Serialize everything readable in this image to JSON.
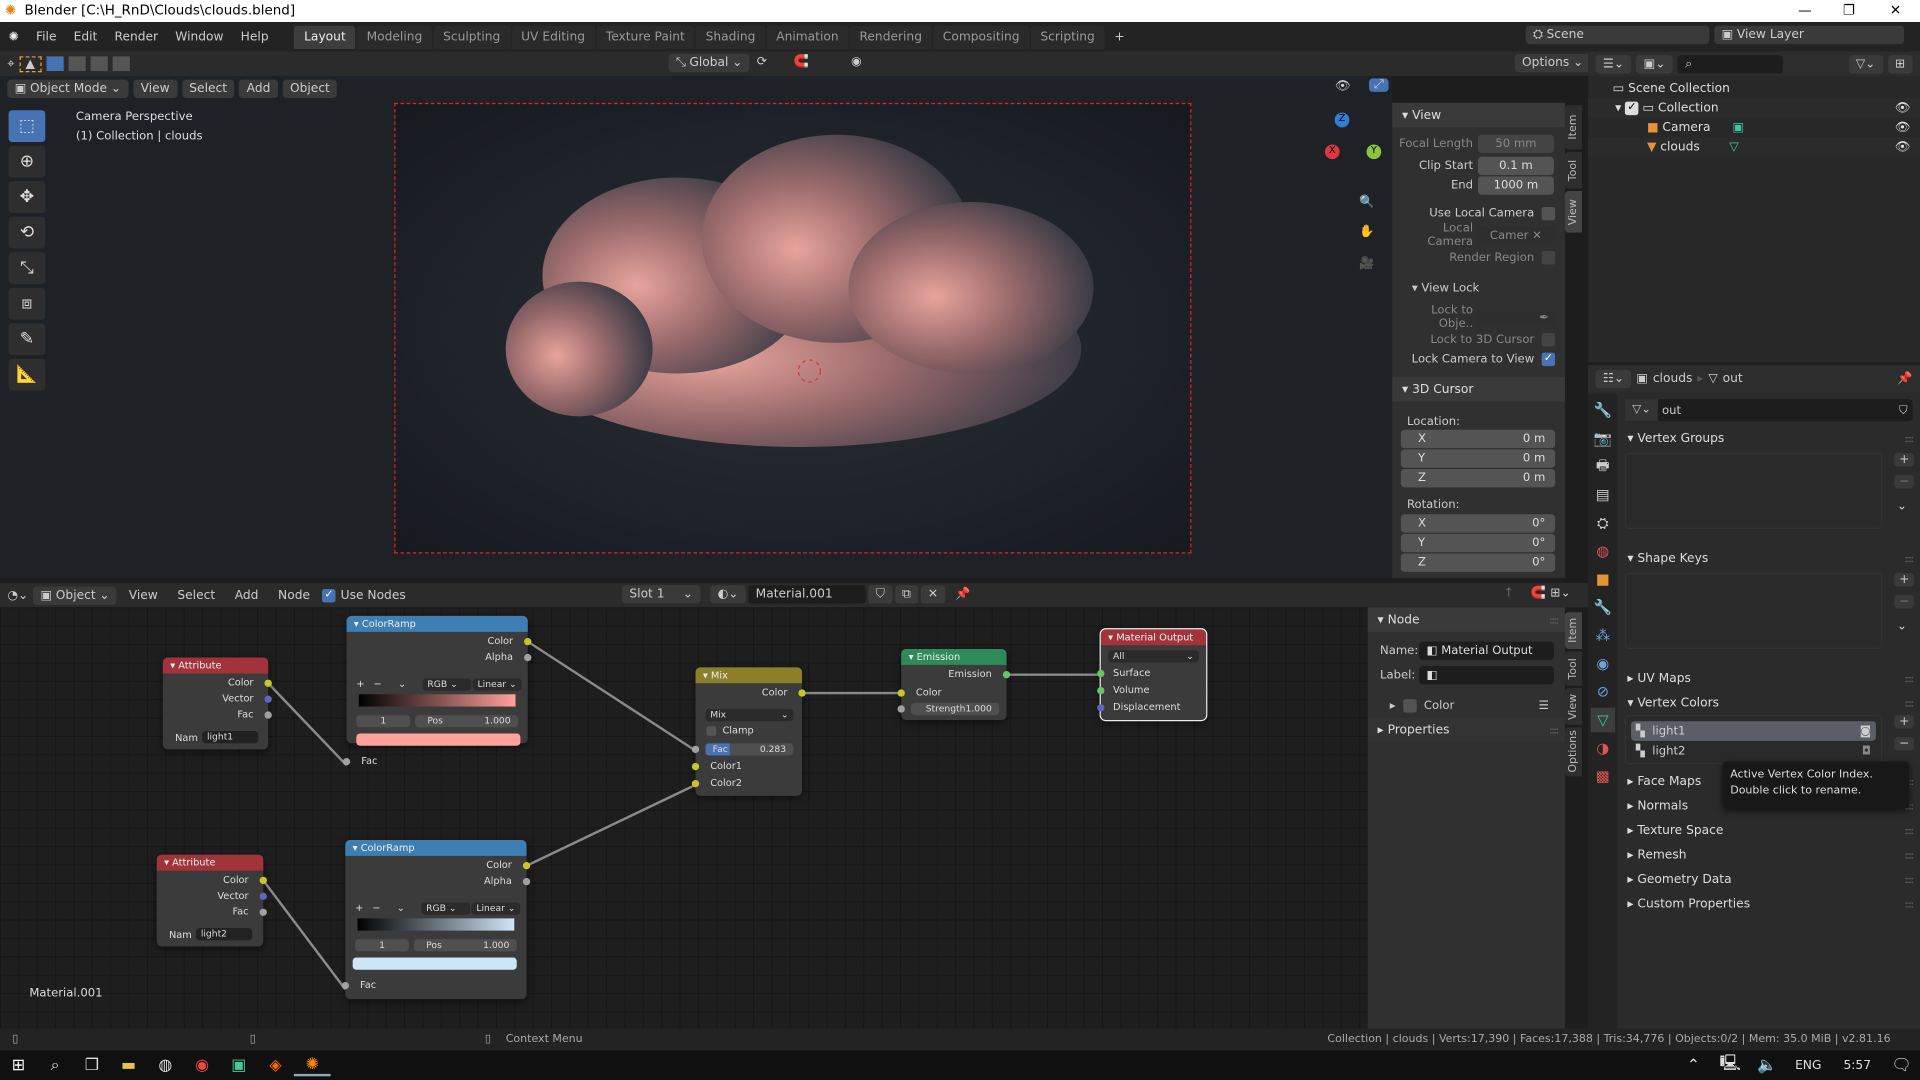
{
  "window": {
    "title": "Blender [C:\\H_RnD\\Clouds\\clouds.blend]",
    "minimize": "—",
    "maximize": "❐",
    "close": "✕"
  },
  "menu": [
    "File",
    "Edit",
    "Render",
    "Window",
    "Help"
  ],
  "workspaces": [
    "Layout",
    "Modeling",
    "Sculpting",
    "UV Editing",
    "Texture Paint",
    "Shading",
    "Animation",
    "Rendering",
    "Compositing",
    "Scripting"
  ],
  "active_workspace": "Layout",
  "scene": {
    "label": "Scene",
    "view_layer": "View Layer"
  },
  "tool_header": {
    "orientation": "Global",
    "options": "Options"
  },
  "viewport": {
    "mode": "Object Mode",
    "menus": [
      "View",
      "Select",
      "Add",
      "Object"
    ],
    "overlay_title": "Camera Perspective",
    "overlay_sub": "(1) Collection | clouds",
    "gizmo": {
      "x": "X",
      "y": "Y",
      "z": "Z"
    }
  },
  "npanel": {
    "tabs": [
      "Item",
      "Tool",
      "View"
    ],
    "view_header": "View",
    "focal_length_label": "Focal Length",
    "focal_length": "50 mm",
    "clip_start_label": "Clip Start",
    "clip_start": "0.1 m",
    "end_label": "End",
    "end": "1000 m",
    "use_local_camera": "Use Local Camera",
    "local_camera_label": "Local Camera",
    "local_camera": "Camer",
    "render_region": "Render Region",
    "view_lock": "View Lock",
    "lock_to_object": "Lock to Obje..",
    "lock_to_cursor": "Lock to 3D Cursor",
    "lock_camera": "Lock Camera to View",
    "lock_camera_checked": true,
    "cursor_header": "3D Cursor",
    "location": "Location:",
    "rotation": "Rotation:",
    "loc": [
      {
        "axis": "X",
        "value": "0 m"
      },
      {
        "axis": "Y",
        "value": "0 m"
      },
      {
        "axis": "Z",
        "value": "0 m"
      }
    ],
    "rot": [
      {
        "axis": "X",
        "value": "0°"
      },
      {
        "axis": "Y",
        "value": "0°"
      },
      {
        "axis": "Z",
        "value": "0°"
      }
    ]
  },
  "outliner": {
    "root": "Scene Collection",
    "collection": "Collection",
    "items": [
      {
        "name": "Camera"
      },
      {
        "name": "clouds"
      }
    ]
  },
  "properties": {
    "breadcrumb_object": "clouds",
    "breadcrumb_data": "out",
    "mesh_name": "out",
    "vertex_groups": "Vertex Groups",
    "shape_keys": "Shape Keys",
    "uv_maps": "UV Maps",
    "vertex_colors": "Vertex Colors",
    "vc_items": [
      "light1",
      "light2"
    ],
    "tooltip_line1": "Active Vertex Color Index.",
    "tooltip_line2": "Double click to rename.",
    "face_maps": "Face Maps",
    "sections": [
      "Normals",
      "Texture Space",
      "Remesh",
      "Geometry Data",
      "Custom Properties"
    ]
  },
  "node_editor": {
    "type": "Object",
    "menus": [
      "View",
      "Select",
      "Add",
      "Node"
    ],
    "use_nodes": "Use Nodes",
    "slot": "Slot 1",
    "material": "Material.001",
    "material_label": "Material.001",
    "side": {
      "tabs": [
        "Item",
        "Tool",
        "View",
        "Options"
      ],
      "node_header": "Node",
      "name_label": "Name:",
      "name": "Material Output",
      "label_label": "Label:",
      "color": "Color",
      "properties": "Properties"
    },
    "nodes": {
      "attr1": {
        "title": "Attribute",
        "outs": [
          "Color",
          "Vector",
          "Fac"
        ],
        "nam": "Nam",
        "value": "light1"
      },
      "attr2": {
        "title": "Attribute",
        "outs": [
          "Color",
          "Vector",
          "Fac"
        ],
        "nam": "Nam",
        "value": "light2"
      },
      "ramp1": {
        "title": "ColorRamp",
        "outs": [
          "Color",
          "Alpha"
        ],
        "mode": "RGB",
        "interp": "Linear",
        "index": "1",
        "pos_label": "Pos",
        "pos": "1.000",
        "in": "Fac",
        "color": "#ffa19c"
      },
      "ramp2": {
        "title": "ColorRamp",
        "outs": [
          "Color",
          "Alpha"
        ],
        "mode": "RGB",
        "interp": "Linear",
        "index": "1",
        "pos_label": "Pos",
        "pos": "1.000",
        "in": "Fac",
        "color": "#cfe6f7"
      },
      "mix": {
        "title": "Mix",
        "out": "Color",
        "blend": "Mix",
        "clamp": "Clamp",
        "fac_label": "Fac",
        "fac": "0.283",
        "fac_value": 0.283,
        "in1": "Color1",
        "in2": "Color2"
      },
      "emission": {
        "title": "Emission",
        "out": "Emission",
        "in": "Color",
        "strength_label": "Strength",
        "strength": "1.000"
      },
      "output": {
        "title": "Material Output",
        "target": "All",
        "ins": [
          "Surface",
          "Volume",
          "Displacement"
        ]
      }
    }
  },
  "status": {
    "context": "Context Menu",
    "stats": "Collection | clouds | Verts:17,390 | Faces:17,388 | Tris:34,776 | Objects:0/2 | Mem: 35.0 MiB | v2.81.16"
  },
  "taskbar": {
    "lang": "ENG",
    "time": "5:57"
  },
  "colors": {
    "accent": "#4772b3",
    "attribute_header": "#a3333b",
    "colorramp_header": "#3e7fb3",
    "mix_header": "#8c7f2a",
    "emission_header": "#2f8a5a",
    "output_header": "#a3333b"
  }
}
